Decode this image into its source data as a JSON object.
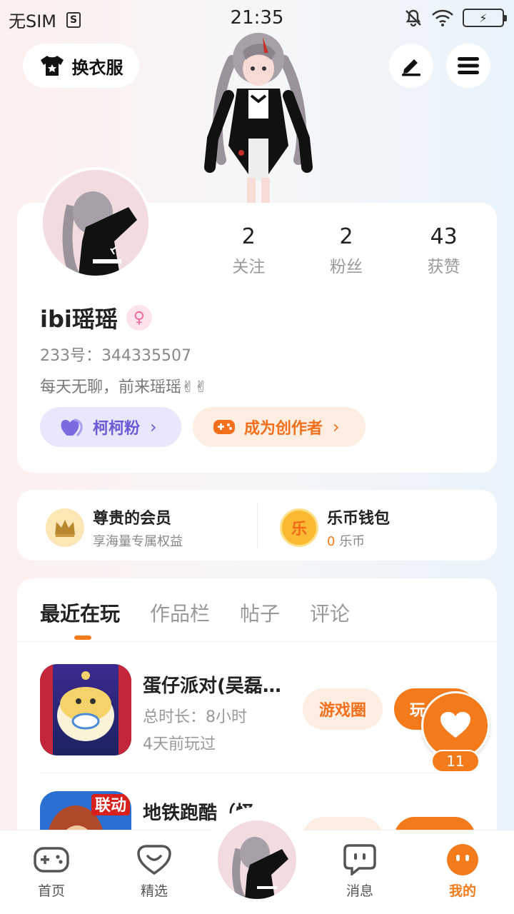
{
  "status_bar": {
    "carrier": "无SIM",
    "sim_badge": "S",
    "time": "21:35",
    "icons": [
      "mute-icon",
      "wifi-icon",
      "battery-charging-icon"
    ]
  },
  "top_bar": {
    "wardrobe_label": "换衣服",
    "edit_icon": "pen-icon",
    "menu_icon": "hamburger-menu-icon"
  },
  "profile": {
    "stats": [
      {
        "value": "2",
        "label": "关注"
      },
      {
        "value": "2",
        "label": "粉丝"
      },
      {
        "value": "43",
        "label": "获赞"
      }
    ],
    "nickname": "ibi瑶瑶",
    "gender_icon": "female-icon",
    "uid": "233号：344335507",
    "bio": "每天无聊，前来瑶瑶✌✌",
    "fan_pill": "柯柯粉",
    "creator_pill": "成为创作者"
  },
  "vip": {
    "member_title": "尊贵的会员",
    "member_sub": "享海量专属权益",
    "wallet_title": "乐币钱包",
    "wallet_amount": "0",
    "wallet_unit": "乐币",
    "wallet_icon_text": "乐"
  },
  "tabs": [
    "最近在玩",
    "作品栏",
    "帖子",
    "评论"
  ],
  "games": [
    {
      "name": "蛋仔派对(吴磊…",
      "duration": "总时长：8小时",
      "last_played": "4天前玩过",
      "circle_btn": "游戏圈",
      "play_btn": "玩"
    },
    {
      "name": "地铁跑酷（怪…",
      "icon_badge": "联动"
    }
  ],
  "fab": {
    "like_count": "11"
  },
  "bottom_nav": [
    {
      "label": "首页",
      "icon": "gamepad-icon"
    },
    {
      "label": "精选",
      "icon": "heart-chat-icon"
    },
    {
      "label": "消息",
      "icon": "message-bubble-icon"
    },
    {
      "label": "我的",
      "icon": "profile-face-icon"
    }
  ],
  "colors": {
    "accent": "#f47b1c",
    "fan_pill_bg": "#e8e7fb",
    "fan_pill_text": "#6b5ad8",
    "creator_pill_bg": "#fdeee1"
  }
}
